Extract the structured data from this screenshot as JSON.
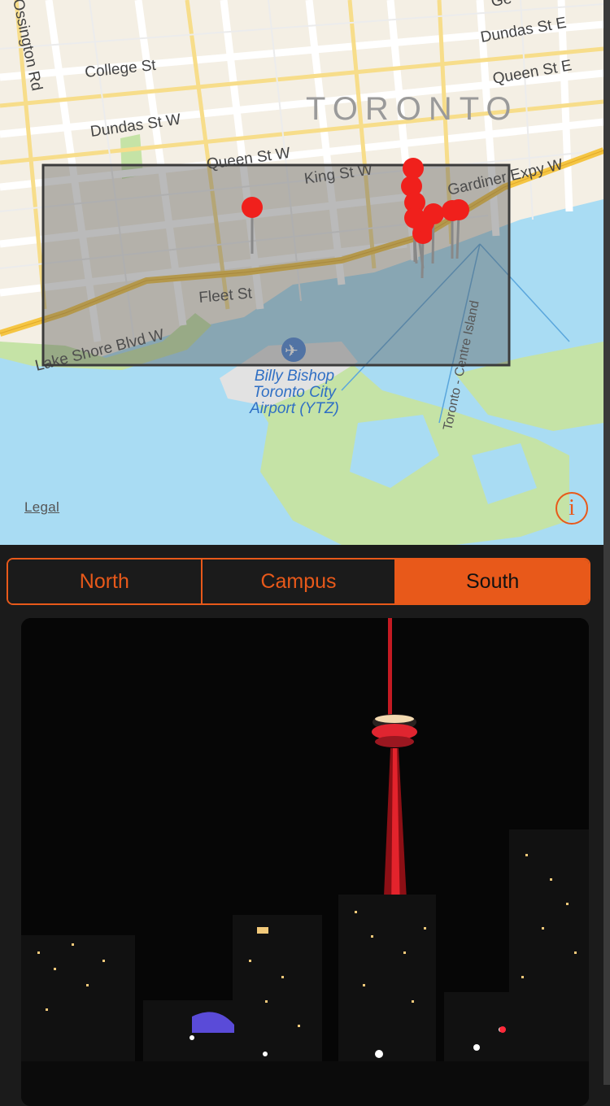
{
  "map": {
    "city_label": "TORONTO",
    "streets": {
      "ossington": "Ossington Rd",
      "college": "College St",
      "dundas_w": "Dundas St W",
      "queen_w": "Queen St W",
      "king_w": "King St W",
      "dundas_e": "Dundas St E",
      "queen_e": "Queen St E",
      "gardiner": "Gardiner Expy W",
      "fleet": "Fleet St",
      "lakeshore": "Lake Shore Blvd W",
      "island": "Toronto - Centre Island",
      "gerrard": "Ge"
    },
    "airport_label": [
      "Billy Bishop",
      "Toronto City",
      "Airport (YTZ)"
    ],
    "legal_link": "Legal",
    "info_button": "i",
    "colors": {
      "water": "#a9dcf3",
      "park": "#c5e3a6",
      "pin": "#f0201c",
      "highway": "#f5c542"
    }
  },
  "segmented_control": {
    "options": [
      "North",
      "Campus",
      "South"
    ],
    "selected_index": 2,
    "accent": "#e8591a"
  },
  "photo": {
    "description_icon": "cn-tower-night-photo"
  }
}
